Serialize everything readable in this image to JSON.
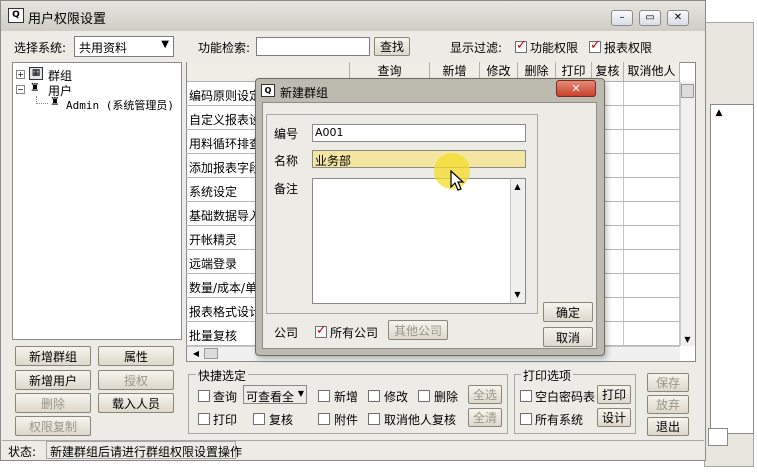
{
  "window": {
    "title": "用户权限设置"
  },
  "left": {
    "system_label": "选择系统:",
    "system_value": "共用资料",
    "tree": {
      "group": "群组",
      "user": "用户",
      "admin": "Admin (系统管理员)"
    }
  },
  "toolbar": {
    "search_label": "功能检索:",
    "search_value": "",
    "search_button": "查找",
    "filter_label": "显示过滤:",
    "filter_func": "功能权限",
    "filter_report": "报表权限"
  },
  "grid": {
    "headers": [
      "查询",
      "新增",
      "修改",
      "删除",
      "打印",
      "复核",
      "取消他人"
    ],
    "rows": [
      "编码原则设定",
      "自定义报表设",
      "用料循环排查",
      "添加报表字段",
      "系统设定",
      "基础数据导入",
      "开帐精灵",
      "远端登录",
      "数量/成本/单",
      "报表格式设计",
      "批量复核"
    ]
  },
  "left_buttons": {
    "new_group": "新增群组",
    "attributes": "属性",
    "new_user": "新增用户",
    "grant": "授权",
    "delete": "删除",
    "import": "载入人员",
    "copy": "权限复制"
  },
  "quick": {
    "title": "快捷选定",
    "query": "查询",
    "query_select": "可查看全",
    "new": "新增",
    "modify": "修改",
    "delete": "删除",
    "select_all": "全选",
    "print": "打印",
    "review": "复核",
    "attach": "附件",
    "cancel_review": "取消他人复核",
    "clear_all": "全清"
  },
  "print_opts": {
    "title": "打印选项",
    "blank_pwd": "空白密码表",
    "print_btn": "打印",
    "all_systems": "所有系统",
    "design_btn": "设计"
  },
  "right_buttons": {
    "save": "保存",
    "discard": "放弃",
    "exit": "退出"
  },
  "status": {
    "label": "状态:",
    "message": "新建群组后请进行群组权限设置操作"
  },
  "dialog": {
    "title": "新建群组",
    "code_label": "编号",
    "code_value": "A001",
    "name_label": "名称",
    "name_value": "业务部",
    "note_label": "备注",
    "ok": "确定",
    "cancel": "取消",
    "company_label": "公司",
    "all_companies": "所有公司",
    "other_companies": "其他公司"
  },
  "colors": {
    "title_bar": "#d9d8d2",
    "dialog_frame": "#b9b5ab",
    "highlight": "#f4e6a0",
    "close_red": "#d5513f"
  }
}
